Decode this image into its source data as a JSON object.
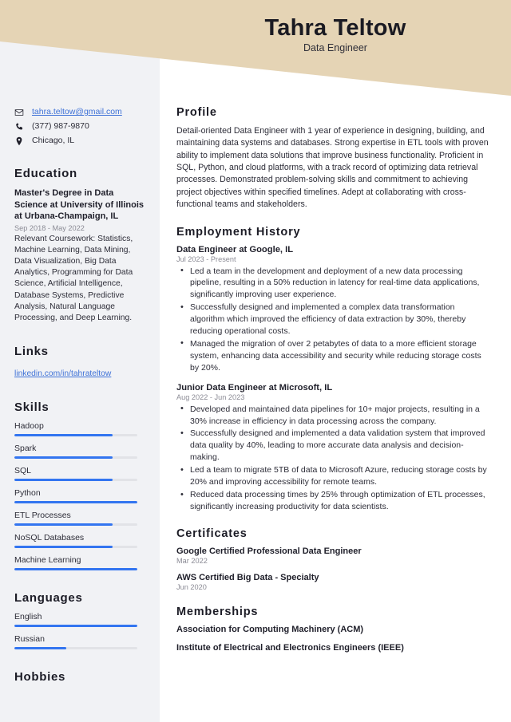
{
  "header": {
    "name": "Tahra Teltow",
    "job_title": "Data Engineer",
    "band_color": "#e5d4b5"
  },
  "sidebar": {
    "contact": [
      {
        "icon": "envelope-icon",
        "text": "tahra.teltow@gmail.com",
        "is_link": true
      },
      {
        "icon": "phone-icon",
        "text": "(377) 987-9870",
        "is_link": false
      },
      {
        "icon": "location-pin-icon",
        "text": "Chicago, IL",
        "is_link": false
      }
    ],
    "education": {
      "heading": "Education",
      "degree": "Master's Degree in Data Science at University of Illinois at Urbana-Champaign, IL",
      "date": "Sep 2018 - May 2022",
      "description": "Relevant Coursework: Statistics, Machine Learning, Data Mining, Data Visualization, Big Data Analytics, Programming for Data Science, Artificial Intelligence, Database Systems, Predictive Analysis, Natural Language Processing, and Deep Learning."
    },
    "links": {
      "heading": "Links",
      "items": [
        {
          "label": "linkedin.com/in/tahrateltow"
        }
      ]
    },
    "skills": {
      "heading": "Skills",
      "items": [
        {
          "label": "Hadoop",
          "level": 80
        },
        {
          "label": "Spark",
          "level": 80
        },
        {
          "label": "SQL",
          "level": 80
        },
        {
          "label": "Python",
          "level": 100
        },
        {
          "label": "ETL Processes",
          "level": 80
        },
        {
          "label": "NoSQL Databases",
          "level": 80
        },
        {
          "label": "Machine Learning",
          "level": 100
        }
      ]
    },
    "languages": {
      "heading": "Languages",
      "items": [
        {
          "label": "English",
          "level": 100
        },
        {
          "label": "Russian",
          "level": 42
        }
      ]
    },
    "hobbies": {
      "heading": "Hobbies"
    },
    "accent_color": "#3375f0",
    "track_color": "#e2e3e7",
    "background_color": "#f1f2f5"
  },
  "main": {
    "profile": {
      "heading": "Profile",
      "text": "Detail-oriented Data Engineer with 1 year of experience in designing, building, and maintaining data systems and databases. Strong expertise in ETL tools with proven ability to implement data solutions that improve business functionality. Proficient in SQL, Python, and cloud platforms, with a track record of optimizing data retrieval processes. Demonstrated problem-solving skills and commitment to achieving project objectives within specified timelines. Adept at collaborating with cross-functional teams and stakeholders."
    },
    "employment": {
      "heading": "Employment History",
      "jobs": [
        {
          "title": "Data Engineer at Google, IL",
          "date": "Jul 2023 - Present",
          "bullets": [
            "Led a team in the development and deployment of a new data processing pipeline, resulting in a 50% reduction in latency for real-time data applications, significantly improving user experience.",
            "Successfully designed and implemented a complex data transformation algorithm which improved the efficiency of data extraction by 30%, thereby reducing operational costs.",
            "Managed the migration of over 2 petabytes of data to a more efficient storage system, enhancing data accessibility and security while reducing storage costs by 20%."
          ]
        },
        {
          "title": "Junior Data Engineer at Microsoft, IL",
          "date": "Aug 2022 - Jun 2023",
          "bullets": [
            "Developed and maintained data pipelines for 10+ major projects, resulting in a 30% increase in efficiency in data processing across the company.",
            "Successfully designed and implemented a data validation system that improved data quality by 40%, leading to more accurate data analysis and decision-making.",
            "Led a team to migrate 5TB of data to Microsoft Azure, reducing storage costs by 20% and improving accessibility for remote teams.",
            "Reduced data processing times by 25% through optimization of ETL processes, significantly increasing productivity for data scientists."
          ]
        }
      ]
    },
    "certificates": {
      "heading": "Certificates",
      "items": [
        {
          "title": "Google Certified Professional Data Engineer",
          "date": "Mar 2022"
        },
        {
          "title": "AWS Certified Big Data - Specialty",
          "date": "Jun 2020"
        }
      ]
    },
    "memberships": {
      "heading": "Memberships",
      "items": [
        {
          "label": "Association for Computing Machinery (ACM)"
        },
        {
          "label": "Institute of Electrical and Electronics Engineers (IEEE)"
        }
      ]
    }
  }
}
